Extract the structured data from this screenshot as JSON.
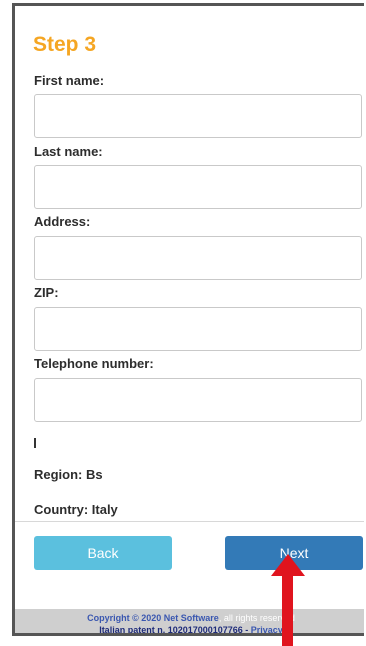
{
  "form": {
    "step_title": "Step 3",
    "fields": [
      {
        "label": "First name:",
        "value": ""
      },
      {
        "label": "Last name:",
        "value": ""
      },
      {
        "label": "Address:",
        "value": ""
      },
      {
        "label": "ZIP:",
        "value": ""
      },
      {
        "label": "Telephone number:",
        "value": ""
      }
    ],
    "region": "Region: Bs",
    "country": "Country: Italy"
  },
  "buttons": {
    "back_label": "Back",
    "next_label": "Next"
  },
  "footer": {
    "copyright_prefix": "Copyright © 2020 Net Software",
    "copyright_suffix": ", all rights reserved",
    "patent": "Italian patent n. 102017000107766 - ",
    "privacy_link": "Privacy"
  },
  "colors": {
    "step_title": "#f5a623",
    "back_button": "#5bc0de",
    "next_button": "#337ab7",
    "annotation_arrow": "#e0141e"
  },
  "icons": {
    "annotation": "red-arrow-up-icon"
  }
}
